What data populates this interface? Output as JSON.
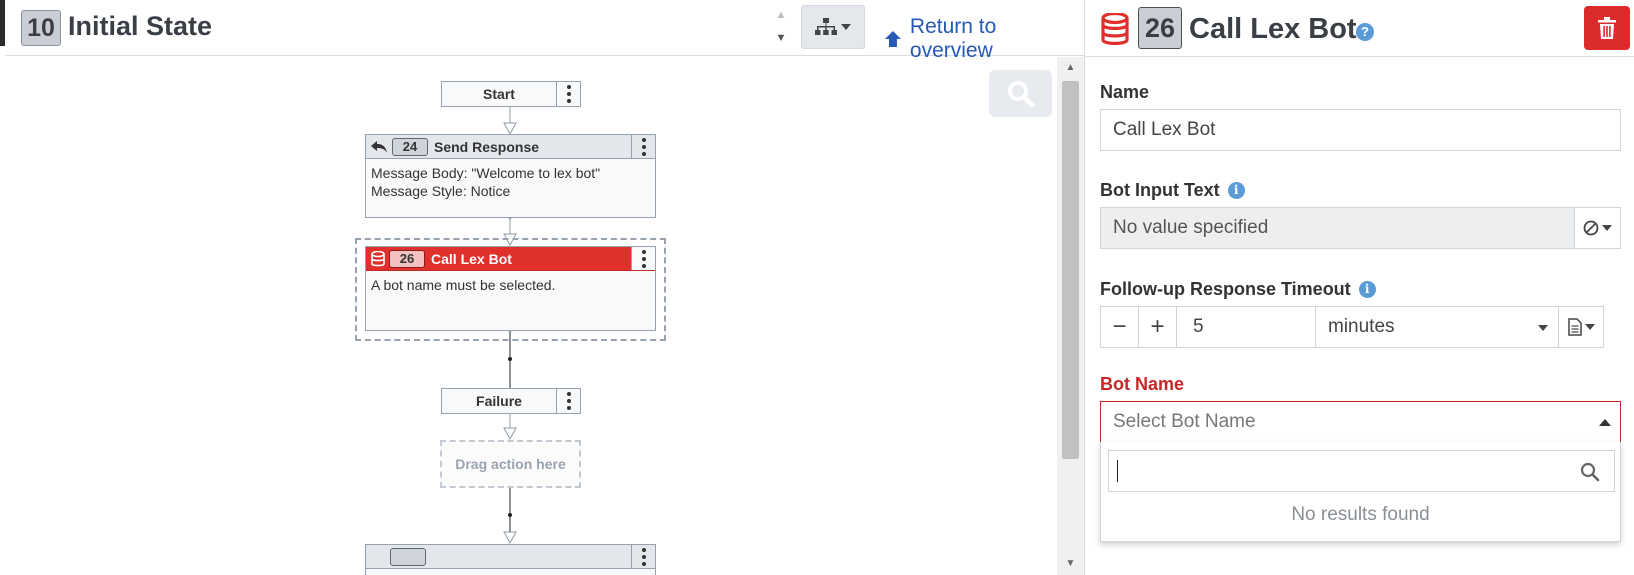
{
  "left_header": {
    "state_number": "10",
    "state_title": "Initial State",
    "return_link": "Return to overview"
  },
  "flow": {
    "start_label": "Start",
    "send_response": {
      "number": "24",
      "title": "Send Response",
      "line1": "Message Body: \"Welcome to lex bot\"",
      "line2": "Message Style: Notice"
    },
    "call_lex_bot": {
      "number": "26",
      "title": "Call Lex Bot",
      "message": "A bot name must be selected."
    },
    "failure_label": "Failure",
    "drop_zone_label": "Drag action here"
  },
  "panel": {
    "number": "26",
    "title": "Call Lex Bot",
    "help_glyph": "?",
    "name_label": "Name",
    "name_value": "Call Lex Bot",
    "bot_input_label": "Bot Input Text",
    "bot_input_value": "No value specified",
    "timeout_label": "Follow-up Response Timeout",
    "timeout_value": "5",
    "timeout_unit": "minutes",
    "bot_name_label": "Bot Name",
    "bot_name_placeholder": "Select Bot Name",
    "no_results": "No results found",
    "minus_glyph": "−",
    "plus_glyph": "+",
    "info_glyph": "i"
  },
  "colors": {
    "accent_blue": "#2559b7",
    "error_red": "#e0302c",
    "info_blue": "#5b9bd5"
  }
}
